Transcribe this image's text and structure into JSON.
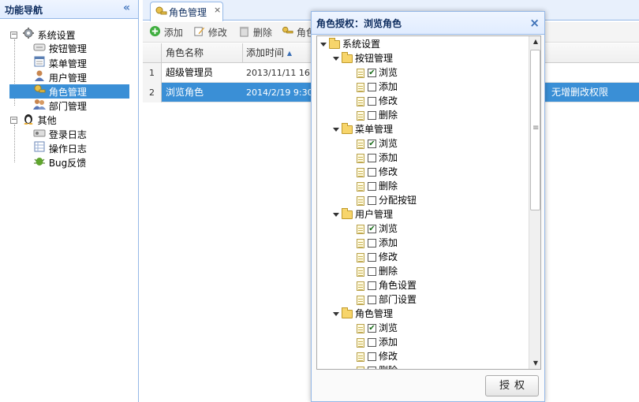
{
  "nav": {
    "title": "功能导航",
    "collapse_icon": "«",
    "items": [
      {
        "label": "系统设置",
        "toggle": "−",
        "icon": "gear-icon"
      },
      {
        "label": "按钮管理",
        "icon": "button-icon"
      },
      {
        "label": "菜单管理",
        "icon": "menu-icon"
      },
      {
        "label": "用户管理",
        "icon": "user-icon"
      },
      {
        "label": "角色管理",
        "icon": "role-icon"
      },
      {
        "label": "部门管理",
        "icon": "department-icon"
      },
      {
        "label": "其他",
        "toggle": "−",
        "icon": "penguin-icon"
      },
      {
        "label": "登录日志",
        "icon": "login-log-icon"
      },
      {
        "label": "操作日志",
        "icon": "operation-log-icon"
      },
      {
        "label": "Bug反馈",
        "icon": "bug-icon"
      }
    ]
  },
  "tabs": [
    {
      "label": "角色管理",
      "close": "×"
    }
  ],
  "toolbar": {
    "add": "添加",
    "edit": "修改",
    "delete": "删除",
    "auth": "角色"
  },
  "grid": {
    "columns": [
      "角色名称",
      "添加时间"
    ],
    "sort_icon": "▲",
    "rows": [
      {
        "num": "1",
        "name": "超级管理员",
        "time": "2013/11/11 16:"
      },
      {
        "num": "2",
        "name": "浏览角色",
        "time": "2014/2/19 9:30",
        "remark": "，无增删改权限"
      }
    ]
  },
  "dialog": {
    "title": "角色授权：浏览角色",
    "close": "×",
    "button": "授权",
    "tree": {
      "root": "系统设置",
      "groups": [
        {
          "label": "按钮管理",
          "children": [
            {
              "label": "浏览",
              "checked": true
            },
            {
              "label": "添加",
              "checked": false
            },
            {
              "label": "修改",
              "checked": false
            },
            {
              "label": "删除",
              "checked": false
            }
          ]
        },
        {
          "label": "菜单管理",
          "children": [
            {
              "label": "浏览",
              "checked": true
            },
            {
              "label": "添加",
              "checked": false
            },
            {
              "label": "修改",
              "checked": false
            },
            {
              "label": "删除",
              "checked": false
            },
            {
              "label": "分配按钮",
              "checked": false
            }
          ]
        },
        {
          "label": "用户管理",
          "children": [
            {
              "label": "浏览",
              "checked": true
            },
            {
              "label": "添加",
              "checked": false
            },
            {
              "label": "修改",
              "checked": false
            },
            {
              "label": "删除",
              "checked": false
            },
            {
              "label": "角色设置",
              "checked": false
            },
            {
              "label": "部门设置",
              "checked": false
            }
          ]
        },
        {
          "label": "角色管理",
          "children": [
            {
              "label": "浏览",
              "checked": true
            },
            {
              "label": "添加",
              "checked": false
            },
            {
              "label": "修改",
              "checked": false
            },
            {
              "label": "删除",
              "checked": false
            }
          ]
        }
      ]
    }
  },
  "colors": {
    "selected": "#3a8fd6",
    "border": "#95b8e7",
    "header_text": "#0e2d5f"
  }
}
